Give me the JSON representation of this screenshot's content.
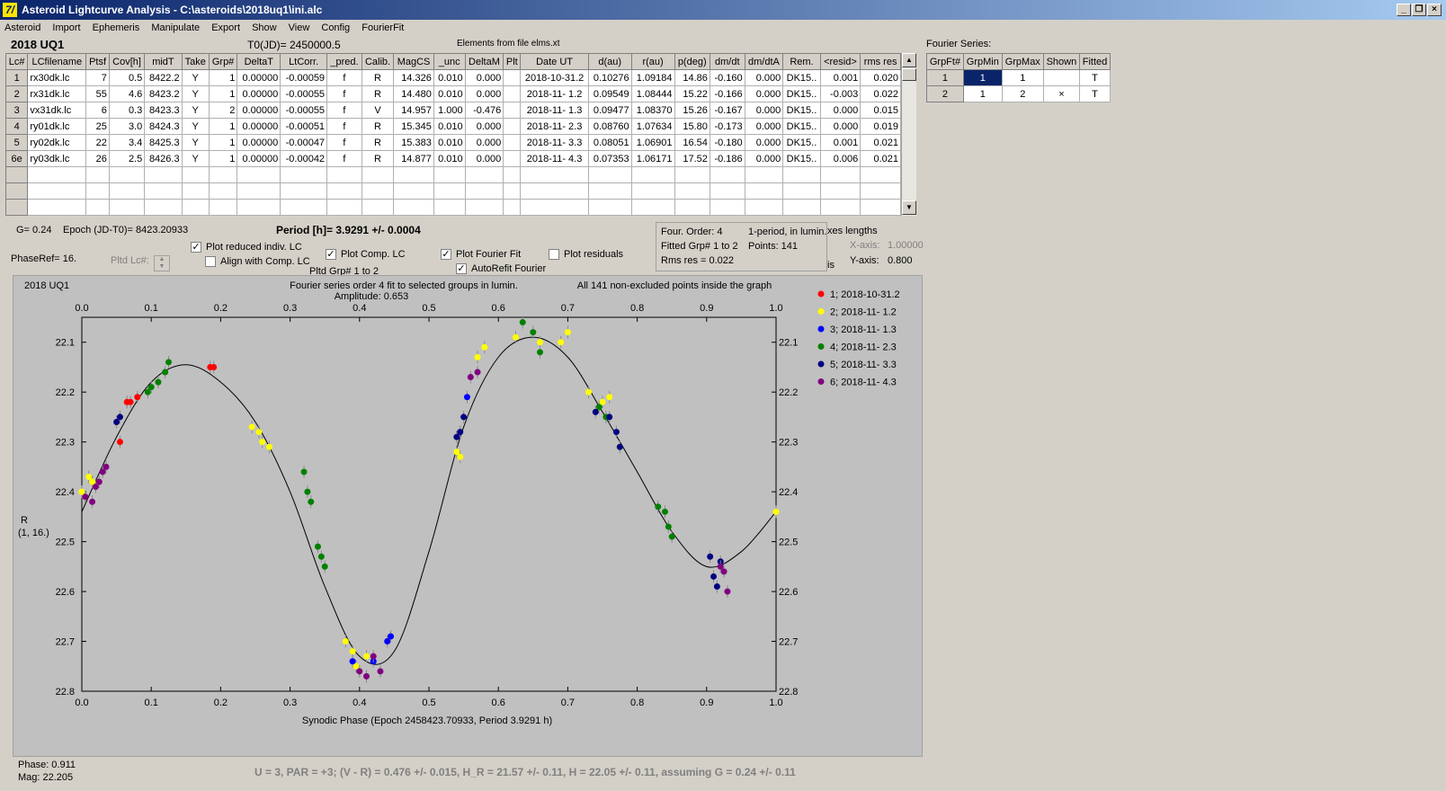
{
  "window": {
    "title": "Asteroid Lightcurve Analysis - C:\\asteroids\\2018uq1\\ini.alc",
    "icon_glyph": "7/"
  },
  "menu": [
    "Asteroid",
    "Import",
    "Ephemeris",
    "Manipulate",
    "Export",
    "Show",
    "View",
    "Config",
    "FourierFit"
  ],
  "header": {
    "object": "2018 UQ1",
    "t0": "T0(JD)= 2450000.5",
    "elements": "Elements from file elms.xt"
  },
  "lc_table": {
    "columns": [
      "Lc#",
      "LCfilename",
      "Ptsf",
      "Cov[h]",
      "midT",
      "Take",
      "Grp#",
      "DeltaT",
      "LtCorr.",
      "_pred.",
      "Calib.",
      "MagCS",
      "_unc",
      "DeltaM",
      "Plt",
      "Date UT",
      "d(au)",
      "r(au)",
      "p(deg)",
      "dm/dt",
      "dm/dtA",
      "Rem.",
      "<resid>",
      "rms res"
    ],
    "rows": [
      [
        "1",
        "rx30dk.lc",
        "7",
        "0.5",
        "8422.2",
        "Y",
        "1",
        "0.00000",
        "-0.00059",
        "f",
        "R",
        "14.326",
        "0.010",
        "0.000",
        "",
        "2018-10-31.2",
        "0.10276",
        "1.09184",
        "14.86",
        "-0.160",
        "0.000",
        "DK15..",
        "0.001",
        "0.020"
      ],
      [
        "2",
        "rx31dk.lc",
        "55",
        "4.6",
        "8423.2",
        "Y",
        "1",
        "0.00000",
        "-0.00055",
        "f",
        "R",
        "14.480",
        "0.010",
        "0.000",
        "",
        "2018-11- 1.2",
        "0.09549",
        "1.08444",
        "15.22",
        "-0.166",
        "0.000",
        "DK15..",
        "-0.003",
        "0.022"
      ],
      [
        "3",
        "vx31dk.lc",
        "6",
        "0.3",
        "8423.3",
        "Y",
        "2",
        "0.00000",
        "-0.00055",
        "f",
        "V",
        "14.957",
        "1.000",
        "-0.476",
        "",
        "2018-11- 1.3",
        "0.09477",
        "1.08370",
        "15.26",
        "-0.167",
        "0.000",
        "DK15..",
        "0.000",
        "0.015"
      ],
      [
        "4",
        "ry01dk.lc",
        "25",
        "3.0",
        "8424.3",
        "Y",
        "1",
        "0.00000",
        "-0.00051",
        "f",
        "R",
        "15.345",
        "0.010",
        "0.000",
        "",
        "2018-11- 2.3",
        "0.08760",
        "1.07634",
        "15.80",
        "-0.173",
        "0.000",
        "DK15..",
        "0.000",
        "0.019"
      ],
      [
        "5",
        "ry02dk.lc",
        "22",
        "3.4",
        "8425.3",
        "Y",
        "1",
        "0.00000",
        "-0.00047",
        "f",
        "R",
        "15.383",
        "0.010",
        "0.000",
        "",
        "2018-11- 3.3",
        "0.08051",
        "1.06901",
        "16.54",
        "-0.180",
        "0.000",
        "DK15..",
        "0.001",
        "0.021"
      ],
      [
        "6e",
        "ry03dk.lc",
        "26",
        "2.5",
        "8426.3",
        "Y",
        "1",
        "0.00000",
        "-0.00042",
        "f",
        "R",
        "14.877",
        "0.010",
        "0.000",
        "",
        "2018-11- 4.3",
        "0.07353",
        "1.06171",
        "17.52",
        "-0.186",
        "0.000",
        "DK15..",
        "0.006",
        "0.021"
      ]
    ]
  },
  "fourier_series": {
    "title": "Fourier Series:",
    "columns": [
      "GrpFt#",
      "GrpMin",
      "GrpMax",
      "Shown",
      "Fitted"
    ],
    "rows": [
      [
        "1",
        "1",
        "1",
        "",
        "T"
      ],
      [
        "2",
        "1",
        "2",
        "×",
        "T"
      ]
    ]
  },
  "params": {
    "g": "G= 0.24",
    "epoch": "Epoch (JD-T0)= 8423.20933",
    "period": "Period [h]= 3.9291 +/- 0.0004",
    "phaseref": "PhaseRef= 16.",
    "pltd_lc": "Pltd Lc#:",
    "pltd_grp": "Pltd Grp#  1   to   2"
  },
  "checkboxes": {
    "plot_reduced": {
      "label": "Plot reduced indiv. LC",
      "checked": true
    },
    "align_comp": {
      "label": "Align with Comp. LC",
      "checked": false
    },
    "plot_comp": {
      "label": "Plot Comp. LC",
      "checked": true
    },
    "plot_fourier": {
      "label": "Plot Fourier Fit",
      "checked": true
    },
    "autorefit": {
      "label": "AutoRefit Fourier",
      "checked": true
    },
    "plot_residuals": {
      "label": "Plot residuals",
      "checked": false
    }
  },
  "stats": {
    "order": "Four. Order:  4",
    "period_mode": "1-period, in lumin.",
    "fitted_grp": "Fitted Grp# 1 to 2",
    "points": "Points: 141",
    "rms": "Rms res     = 0.022"
  },
  "axes_lengths": {
    "title": "xes lengths",
    "xlabel": "X-axis:",
    "xval": "1.00000",
    "ylabel": "Y-axis:",
    "yval": "0.800",
    "cut": "is"
  },
  "readout": {
    "phase": "Phase:  0.911",
    "mag": "Mag:    22.205"
  },
  "footer": "U = 3, PAR = +3; (V - R) = 0.476 +/- 0.015, H_R = 21.57 +/- 0.11, H = 22.05 +/- 0.11, assuming G = 0.24 +/- 0.11",
  "colors": {
    "g1": "#ff0000",
    "g2": "#ffff00",
    "g3": "#0000ff",
    "g4": "#008000",
    "g5": "#000080",
    "g6": "#800080",
    "curve": "#000000",
    "plot_bg": "#c0c0c0"
  },
  "chart_data": {
    "type": "scatter",
    "title": "Fourier series order 4 fit to selected groups in lumin.",
    "subtitle": "Amplitude: 0.653",
    "object_label": "2018 UQ1",
    "note": "All 141 non-excluded points inside the graph",
    "xlabel": "Synodic Phase (Epoch 2458423.70933, Period 3.9291 h)",
    "ylabel": "R",
    "ylabel2": "(1, 16.)",
    "xlim": [
      0.0,
      1.0
    ],
    "ylim": [
      22.8,
      22.05
    ],
    "xticks": [
      "0.0",
      "0.1",
      "0.2",
      "0.3",
      "0.4",
      "0.5",
      "0.6",
      "0.7",
      "0.8",
      "0.9",
      "1.0"
    ],
    "yticks": [
      "22.1",
      "22.2",
      "22.3",
      "22.4",
      "22.5",
      "22.6",
      "22.7",
      "22.8"
    ],
    "legend": [
      "1; 2018-10-31.2",
      "2; 2018-11- 1.2",
      "3; 2018-11- 1.3",
      "4; 2018-11- 2.3",
      "5; 2018-11- 3.3",
      "6; 2018-11- 4.3"
    ],
    "fit_curve": {
      "x": [
        0.0,
        0.05,
        0.1,
        0.15,
        0.2,
        0.25,
        0.3,
        0.35,
        0.4,
        0.45,
        0.5,
        0.55,
        0.6,
        0.65,
        0.7,
        0.75,
        0.8,
        0.85,
        0.9,
        0.95,
        1.0
      ],
      "y": [
        22.44,
        22.29,
        22.18,
        22.145,
        22.18,
        22.26,
        22.4,
        22.59,
        22.73,
        22.72,
        22.52,
        22.27,
        22.13,
        22.09,
        22.13,
        22.24,
        22.36,
        22.48,
        22.55,
        22.52,
        22.44
      ]
    },
    "series": [
      {
        "name": "1; 2018-10-31.2",
        "color": "#ff0000",
        "points": [
          [
            0.055,
            22.3
          ],
          [
            0.065,
            22.22
          ],
          [
            0.07,
            22.22
          ],
          [
            0.08,
            22.21
          ],
          [
            0.185,
            22.15
          ],
          [
            0.19,
            22.15
          ]
        ]
      },
      {
        "name": "2; 2018-11- 1.2",
        "color": "#ffff00",
        "points": [
          [
            0.0,
            22.4
          ],
          [
            0.01,
            22.37
          ],
          [
            0.015,
            22.38
          ],
          [
            0.245,
            22.27
          ],
          [
            0.255,
            22.28
          ],
          [
            0.26,
            22.3
          ],
          [
            0.27,
            22.31
          ],
          [
            0.38,
            22.7
          ],
          [
            0.39,
            22.72
          ],
          [
            0.395,
            22.75
          ],
          [
            0.41,
            22.73
          ],
          [
            0.54,
            22.32
          ],
          [
            0.545,
            22.33
          ],
          [
            0.57,
            22.13
          ],
          [
            0.58,
            22.11
          ],
          [
            0.625,
            22.09
          ],
          [
            0.66,
            22.1
          ],
          [
            0.69,
            22.1
          ],
          [
            0.7,
            22.08
          ],
          [
            0.73,
            22.2
          ],
          [
            0.75,
            22.22
          ],
          [
            0.76,
            22.21
          ],
          [
            1.0,
            22.44
          ]
        ]
      },
      {
        "name": "3; 2018-11- 1.3",
        "color": "#0000ff",
        "points": [
          [
            0.39,
            22.74
          ],
          [
            0.42,
            22.74
          ],
          [
            0.44,
            22.7
          ],
          [
            0.445,
            22.69
          ],
          [
            0.555,
            22.21
          ]
        ]
      },
      {
        "name": "4; 2018-11- 2.3",
        "color": "#008000",
        "points": [
          [
            0.095,
            22.2
          ],
          [
            0.1,
            22.19
          ],
          [
            0.11,
            22.18
          ],
          [
            0.12,
            22.16
          ],
          [
            0.125,
            22.14
          ],
          [
            0.32,
            22.36
          ],
          [
            0.325,
            22.4
          ],
          [
            0.33,
            22.42
          ],
          [
            0.34,
            22.51
          ],
          [
            0.345,
            22.53
          ],
          [
            0.35,
            22.55
          ],
          [
            0.635,
            22.06
          ],
          [
            0.65,
            22.08
          ],
          [
            0.66,
            22.12
          ],
          [
            0.745,
            22.23
          ],
          [
            0.755,
            22.25
          ],
          [
            0.83,
            22.43
          ],
          [
            0.84,
            22.44
          ],
          [
            0.845,
            22.47
          ],
          [
            0.85,
            22.49
          ]
        ]
      },
      {
        "name": "5; 2018-11- 3.3",
        "color": "#000080",
        "points": [
          [
            0.05,
            22.26
          ],
          [
            0.055,
            22.25
          ],
          [
            0.54,
            22.29
          ],
          [
            0.545,
            22.28
          ],
          [
            0.55,
            22.25
          ],
          [
            0.74,
            22.24
          ],
          [
            0.76,
            22.25
          ],
          [
            0.77,
            22.28
          ],
          [
            0.775,
            22.31
          ],
          [
            0.905,
            22.53
          ],
          [
            0.91,
            22.57
          ],
          [
            0.915,
            22.59
          ],
          [
            0.92,
            22.54
          ]
        ]
      },
      {
        "name": "6; 2018-11- 4.3",
        "color": "#800080",
        "points": [
          [
            0.005,
            22.41
          ],
          [
            0.015,
            22.42
          ],
          [
            0.02,
            22.39
          ],
          [
            0.025,
            22.38
          ],
          [
            0.03,
            22.36
          ],
          [
            0.035,
            22.35
          ],
          [
            0.4,
            22.76
          ],
          [
            0.41,
            22.77
          ],
          [
            0.42,
            22.73
          ],
          [
            0.43,
            22.76
          ],
          [
            0.56,
            22.17
          ],
          [
            0.57,
            22.16
          ],
          [
            0.92,
            22.55
          ],
          [
            0.925,
            22.56
          ],
          [
            0.93,
            22.6
          ]
        ]
      }
    ]
  }
}
